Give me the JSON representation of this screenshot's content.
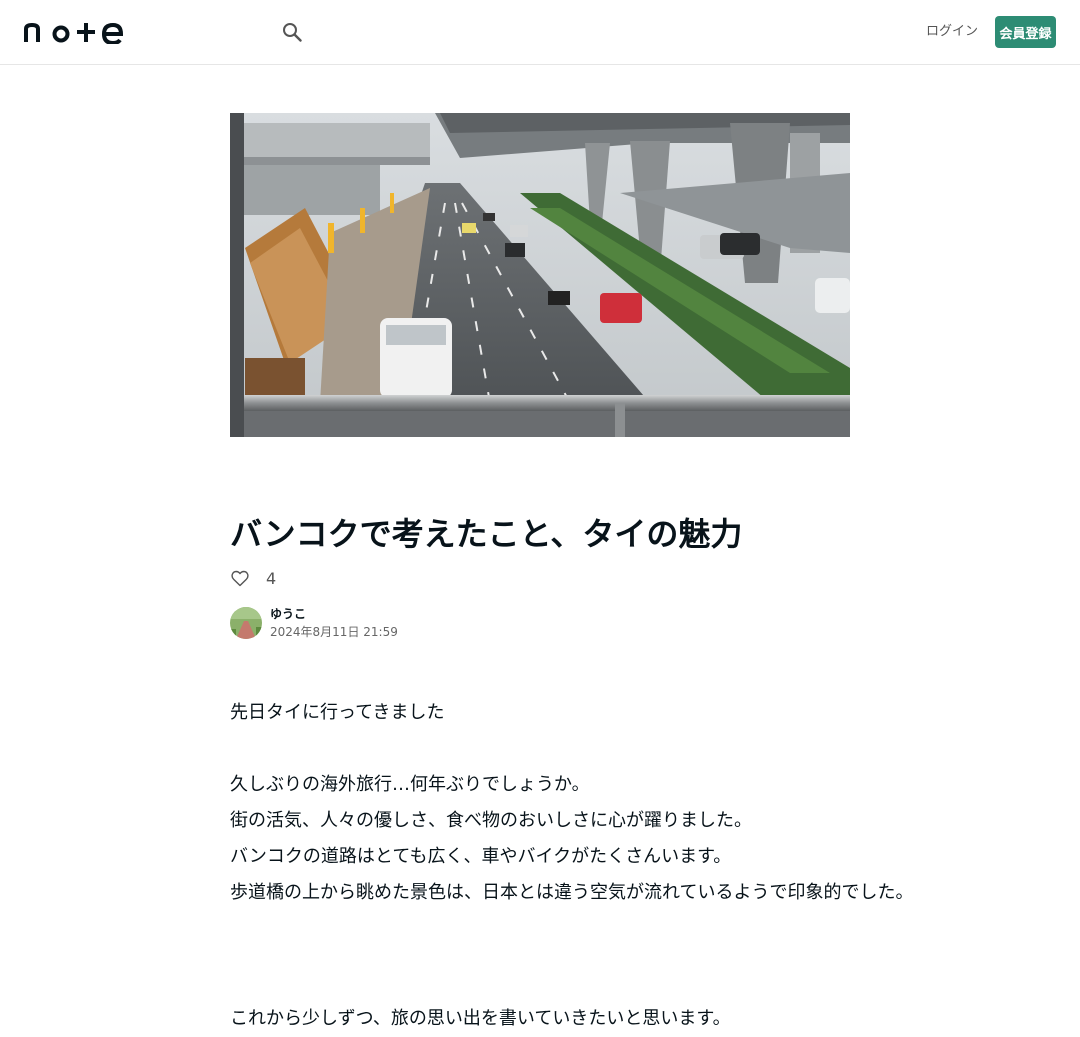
{
  "header": {
    "logo_text": "note",
    "login_label": "ログイン",
    "signup_label": "会員登録"
  },
  "article": {
    "title": "バンコクで考えたこと、タイの魅力",
    "like_count": "4",
    "author_name": "ゆうこ",
    "date": "2024年8月11日 21:59",
    "paragraphs": [
      "先日タイに行ってきました",
      "",
      "久しぶりの海外旅行…何年ぶりでしょうか。",
      "街の活気、人々の優しさ、食べ物のおいしさに心が躍りました。",
      "バンコクの道路はとても広く、車やバイクがたくさんいます。",
      "歩道橋の上から眺めた景色は、日本とは違う空気が流れているようで印象的でした。",
      "",
      "これから少しずつ、旅の思い出を書いていきたいと思います。"
    ]
  },
  "icons": {
    "search": "search-icon",
    "like": "heart-icon"
  },
  "colors": {
    "accent": "#2d8c74",
    "text": "#08131a",
    "muted": "#555555",
    "border": "#e6e6e6"
  }
}
